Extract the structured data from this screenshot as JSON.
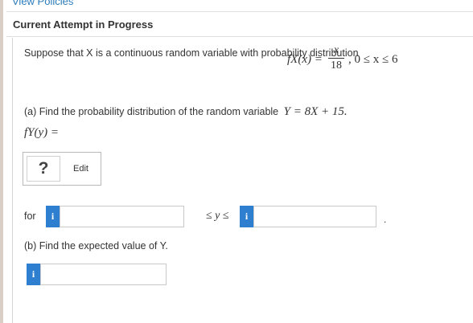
{
  "header": {
    "view_policies": "View Policies",
    "attempt_title": "Current Attempt in Progress"
  },
  "question": {
    "intro": "Suppose that X is a continuous random variable with probability distribution",
    "formula": {
      "lhs": "fX(x) =",
      "numerator": "x",
      "denominator": "18",
      "condition": ", 0 ≤ x ≤ 6"
    },
    "part_a": {
      "prompt": "(a) Find the probability distribution of the random variable",
      "prompt_math": "Y = 8X + 15.",
      "answer_label": "fY(y) =",
      "symbol_button": "?",
      "edit_label": "Edit",
      "for_label": "for",
      "between_label": "≤ y ≤",
      "lower_value": "",
      "upper_value": "",
      "trailing_period": "."
    },
    "part_b": {
      "prompt": "(b) Find the expected value of Y.",
      "answer_value": ""
    },
    "info_icon_glyph": "i"
  },
  "colors": {
    "info_badge": "#2e7fd0",
    "link": "#2b7bbb"
  }
}
